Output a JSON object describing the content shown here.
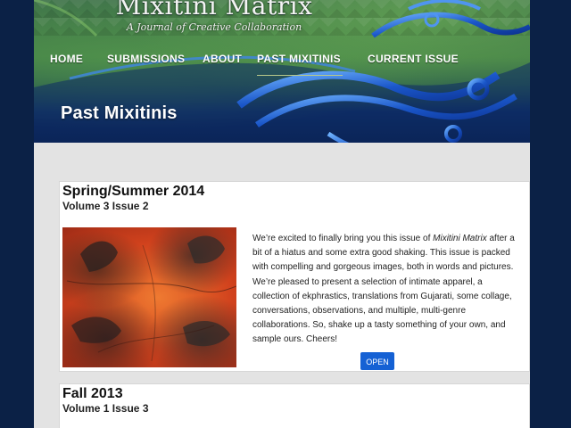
{
  "header": {
    "title": "Mixitini Matrix",
    "tagline": "A Journal of Creative Collaboration",
    "page_heading": "Past Mixitinis"
  },
  "nav": {
    "items": [
      {
        "label": "HOME"
      },
      {
        "label": "SUBMISSIONS"
      },
      {
        "label": "ABOUT"
      },
      {
        "label": "PAST MIXITINIS",
        "active": true
      },
      {
        "label": "CURRENT ISSUE"
      }
    ]
  },
  "issues": [
    {
      "title": "Spring/Summer 2014",
      "volume": "Volume 3 Issue 2",
      "description_before_italic": "We’re excited to finally bring you this issue of ",
      "description_italic": "Mixitini Matrix",
      "description_after_italic": " after a bit of a hiatus and some extra good shaking. This issue is packed with compelling and gorgeous images, both in words and pictures.  We’re pleased to present a selection of intimate apparel, a collection of ekphrastics, translations from Gujarati, some collage, conversations, observations, and multiple, multi-genre collaborations. So, shake up a tasty something of your own, and sample ours. Cheers!",
      "button_label": "OPEN"
    },
    {
      "title": "Fall 2013",
      "volume": "Volume 1 Issue 3"
    }
  ],
  "colors": {
    "background": "#0b2146",
    "content_bg": "#e3e3e3",
    "button": "#1561d4"
  }
}
